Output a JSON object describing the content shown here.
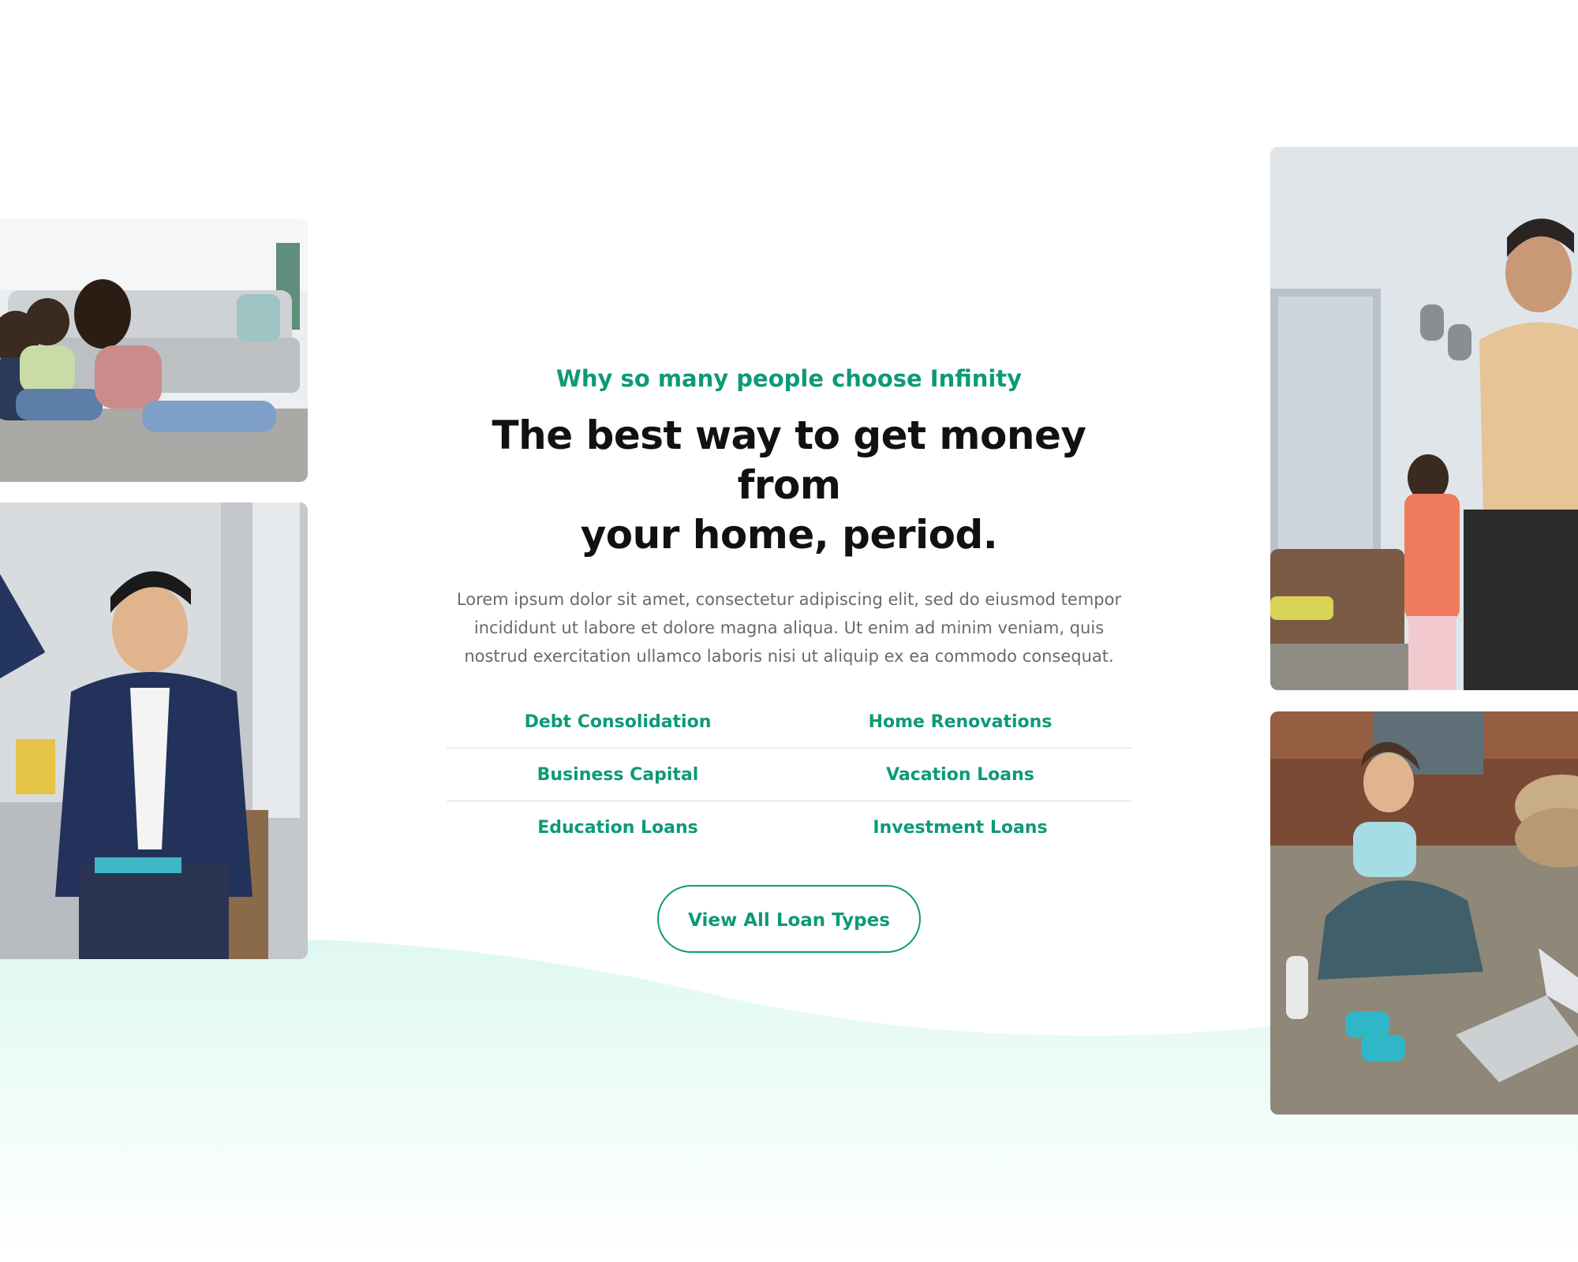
{
  "section": {
    "eyebrow": "Why so many people choose Infinity",
    "headline_line1": "The best way to get money from",
    "headline_line2": "your home, period.",
    "body": "Lorem ipsum dolor sit amet, consectetur adipiscing elit, sed do eiusmod tempor incididunt ut labore et dolore magna aliqua. Ut enim ad minim veniam, quis nostrud exercitation ullamco laboris nisi ut aliquip ex ea commodo consequat.",
    "loan_types": [
      [
        "Debt Consolidation",
        "Home Renovations"
      ],
      [
        "Business Capital",
        "Vacation Loans"
      ],
      [
        "Education Loans",
        "Investment Loans"
      ]
    ],
    "cta_label": "View All Loan Types"
  },
  "colors": {
    "accent": "#0d9a77",
    "heading": "#111111",
    "body": "#666a70",
    "wave": "#e6faf6"
  }
}
